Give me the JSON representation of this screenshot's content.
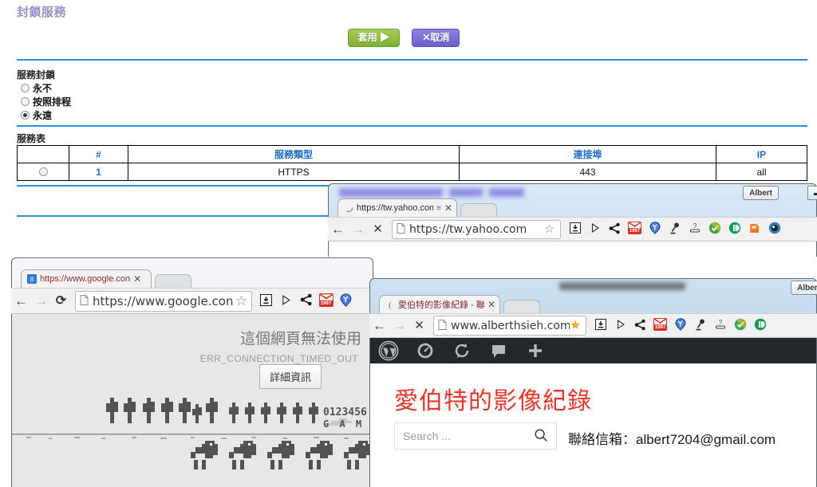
{
  "router": {
    "title": "封鎖服務",
    "buttons": {
      "apply": "套用 ▶",
      "cancel": "✕取消"
    },
    "block_section": {
      "label": "服務封鎖",
      "options": [
        {
          "label": "永不",
          "selected": false
        },
        {
          "label": "按照排程",
          "selected": false
        },
        {
          "label": "永遠",
          "selected": true
        }
      ]
    },
    "table_section": {
      "label": "服務表",
      "headers": [
        "",
        "#",
        "服務類型",
        "連接埠",
        "IP"
      ],
      "rows": [
        {
          "selected": true,
          "num": "1",
          "type": "HTTPS",
          "port": "443",
          "ip": "all"
        }
      ]
    },
    "colors": {
      "title": "#9a8fc7",
      "rule": "#2b8fd6",
      "header_link": "#1d6fc0"
    }
  },
  "window_yahoo": {
    "user_chip": "Albert",
    "tab": {
      "title": "https://tw.yahoo.com/",
      "favicon": "loading-spinner-icon",
      "close": "✕"
    },
    "nav": {
      "back": "←",
      "forward": "→",
      "stop": "✕"
    },
    "omnibox": {
      "url": "https://tw.yahoo.com",
      "bookmark_state": "not-bookmarked"
    },
    "extensions": [
      "download-box-icon",
      "play-triangle-icon",
      "share-icon",
      "gmail-icon",
      "yahoo-pin-icon",
      "lamp-icon",
      "question-underline-icon",
      "green-check-shield-icon",
      "pocket-icon",
      "orange-app-icon",
      "dark-globe-icon"
    ],
    "gmail_badge": "1997"
  },
  "window_google": {
    "tab": {
      "title": "https://www.google.con",
      "favicon": "google-favicon",
      "close": "✕"
    },
    "nav": {
      "back": "←",
      "forward": "→",
      "reload": "⟳"
    },
    "omnibox": {
      "url": "https://www.google.con",
      "bookmark_state": "not-bookmarked"
    },
    "extensions": [
      "download-box-icon",
      "play-triangle-icon",
      "share-icon",
      "gmail-icon",
      "yahoo-pin-icon"
    ],
    "gmail_badge": "1997",
    "error_page": {
      "title": "這個網頁無法使用",
      "code": "ERR_CONNECTION_TIMED_OUT",
      "details_button": "詳細資訊",
      "game_sprite_digits": "0123456",
      "game_sprite_text": "G A M"
    }
  },
  "window_wordpress": {
    "user_chip": "Albert",
    "window_buttons": {
      "minimize": "▬",
      "maximize": "❐",
      "close": "✕"
    },
    "tab": {
      "title": "愛伯特的影像紀錄 - 聯絡",
      "favicon": "wp-favicon",
      "close": "✕"
    },
    "nav": {
      "back": "←",
      "forward": "→",
      "stop": "✕"
    },
    "omnibox": {
      "url": "www.alberthsieh.com",
      "bookmark_state": "bookmarked"
    },
    "extensions": [
      "download-box-icon",
      "play-triangle-icon",
      "share-icon",
      "gmail-icon",
      "yahoo-pin-icon",
      "lamp-icon",
      "question-underline-icon",
      "green-check-shield-icon",
      "pocket-icon"
    ],
    "gmail_badge": "1997",
    "admin_bar": [
      "wordpress-logo-icon",
      "dashboard-gauge-icon",
      "updates-refresh-icon",
      "comments-bubble-icon",
      "new-plus-icon"
    ],
    "site": {
      "title": "愛伯特的影像紀錄",
      "search_placeholder": "Search ...",
      "search_icon": "search-icon",
      "contact": "聯絡信箱：albert7204@gmail.com",
      "title_color": "#e8372a"
    }
  }
}
